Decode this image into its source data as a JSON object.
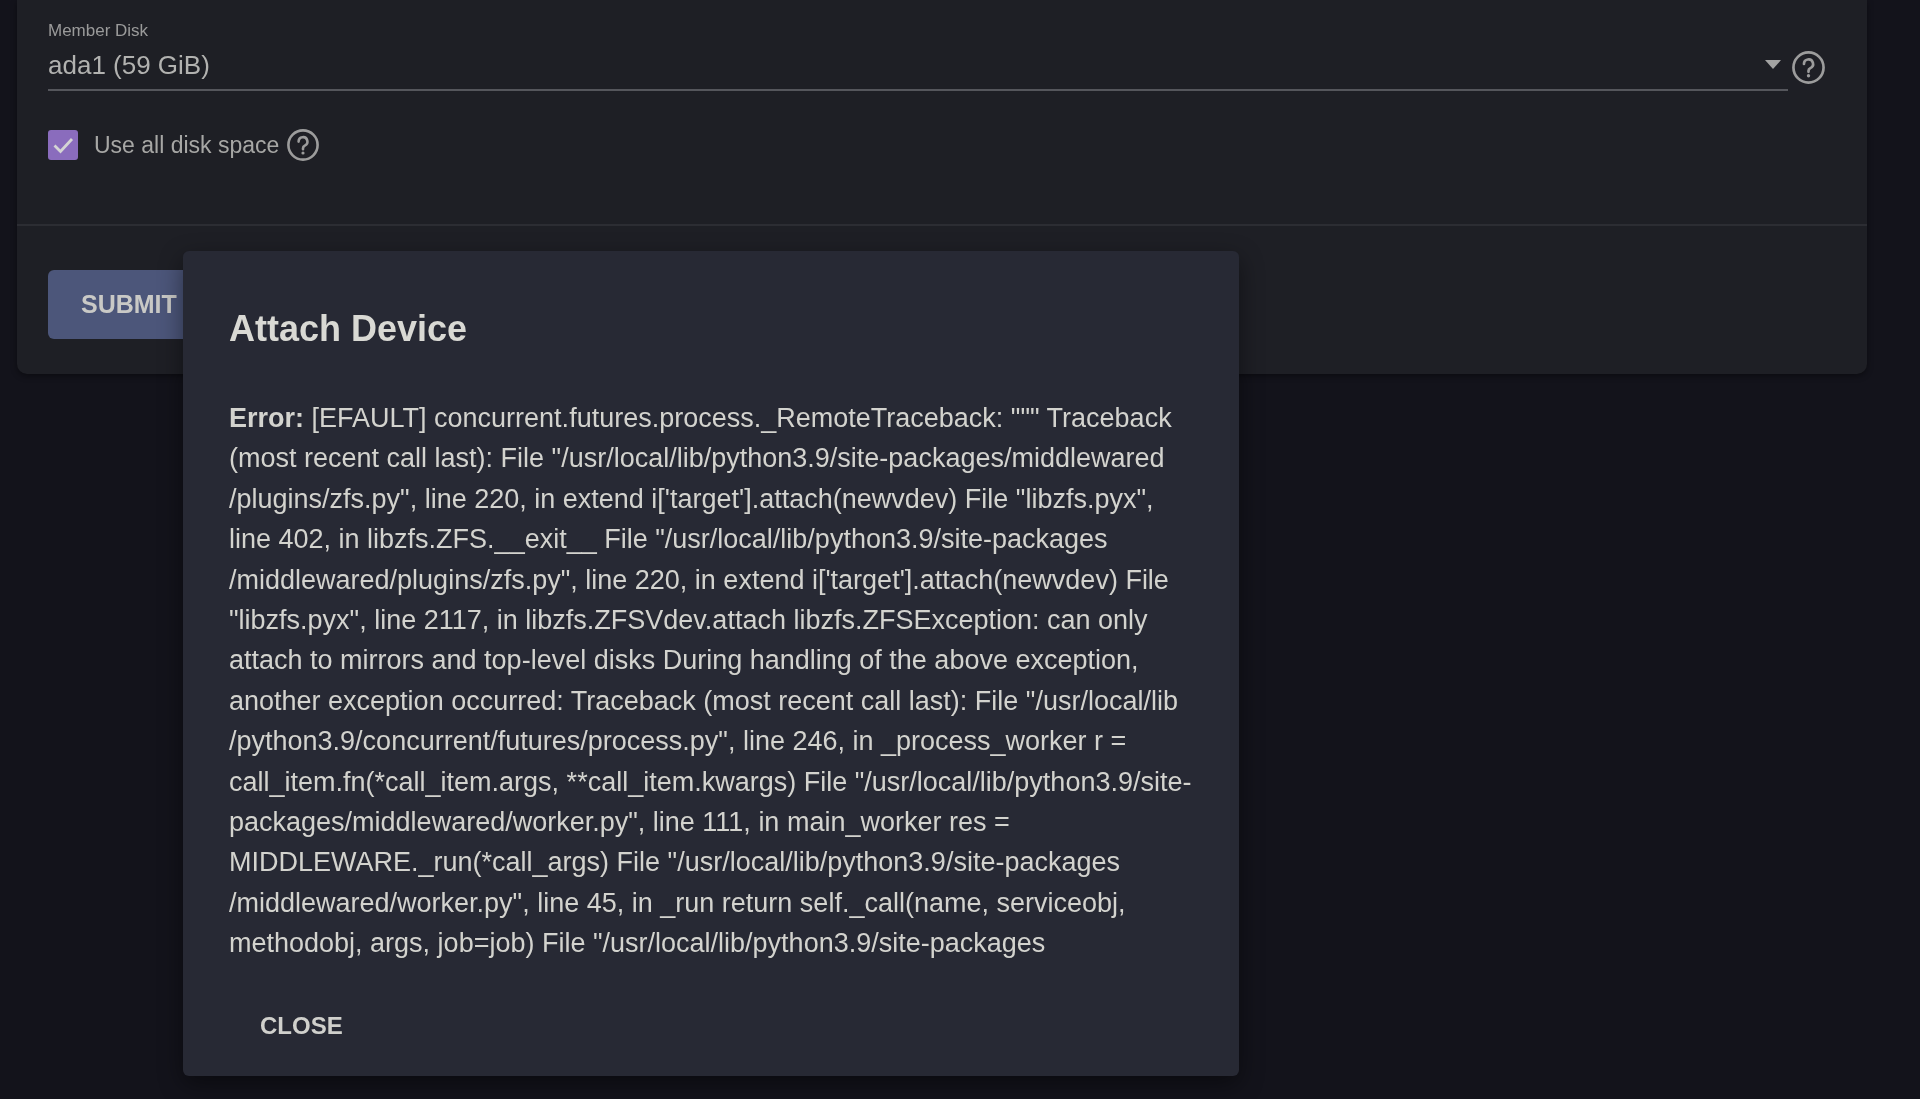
{
  "form": {
    "member_disk": {
      "label": "Member Disk",
      "value": "ada1 (59 GiB)"
    },
    "use_all_disk_space": {
      "label": "Use all disk space",
      "checked": true
    },
    "submit_button": "SUBMIT"
  },
  "dialog": {
    "title": "Attach Device",
    "message": {
      "label": "Error:",
      "text": "[EFAULT] concurrent.futures.process._RemoteTraceback: \"\"\" Traceback (most recent call last): File \"/usr/local/lib/python3.9/site-packages/middlewared/plugins/zfs.py\", line 220, in extend i['target'].attach(newvdev) File \"libzfs.pyx\", line 402, in libzfs.ZFS.__exit__ File \"/usr/local/lib/python3.9/site-packages/middlewared/plugins/zfs.py\", line 220, in extend i['target'].attach(newvdev) File \"libzfs.pyx\", line 2117, in libzfs.ZFSVdev.attach libzfs.ZFSException: can only attach to mirrors and top-level disks During handling of the above exception, another exception occurred: Traceback (most recent call last): File \"/usr/local/lib/python3.9/concurrent/futures/process.py\", line 246, in _process_worker r = call_item.fn(*call_item.args, **call_item.kwargs) File \"/usr/local/lib/python3.9/site-packages/middlewared/worker.py\", line 111, in main_worker res = MIDDLEWARE._run(*call_args) File \"/usr/local/lib/python3.9/site-packages/middlewared/worker.py\", line 45, in _run return self._call(name, serviceobj, methodobj, args, job=job) File \"/usr/local/lib/python3.9/site-packages"
    },
    "close_button": "CLOSE"
  }
}
